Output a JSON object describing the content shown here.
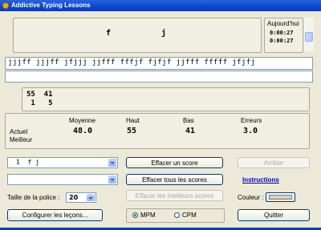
{
  "window": {
    "title": "Addictive Typing Lessons"
  },
  "prompt": {
    "left_key": "f",
    "right_key": "j"
  },
  "today": {
    "label": "Aujourd'hui",
    "time1": "0:00:27",
    "time2": "0:00:27"
  },
  "lesson_text": "jjjff jjjff jfjjj jjfff fffjf fjfjf jjfff fffff jfjfj",
  "typed_text": "",
  "mini_stats": {
    "row1": "55  41",
    "row2": " 1   5"
  },
  "stats": {
    "headers": [
      "Moyenne",
      "Haut",
      "Bas",
      "Erreurs"
    ],
    "row_labels": [
      "Actuel",
      "Meilleur"
    ],
    "values": [
      "48.0",
      "55",
      "41",
      "3.0"
    ]
  },
  "controls": {
    "lesson_select": "1  f j",
    "second_select": "",
    "font_size_label": "Taille de la police :",
    "font_size_value": "20",
    "configure_button": "Configurer les leçons...",
    "clear_score_button": "Effacer un score",
    "clear_all_button": "Effacer tous les scores",
    "clear_best_button": "Effacer les meilleurs scores",
    "stop_button": "Arrêter",
    "instructions_link": "Instructions",
    "color_label": "Couleur :",
    "quit_button": "Quitter",
    "mpm_label": "MPM",
    "cpm_label": "CPM",
    "speed_mode": "MPM"
  },
  "colors": {
    "title_bar": "#0a46c8",
    "panel": "#f1efe2",
    "color_swatch": "#d4d0c8"
  }
}
